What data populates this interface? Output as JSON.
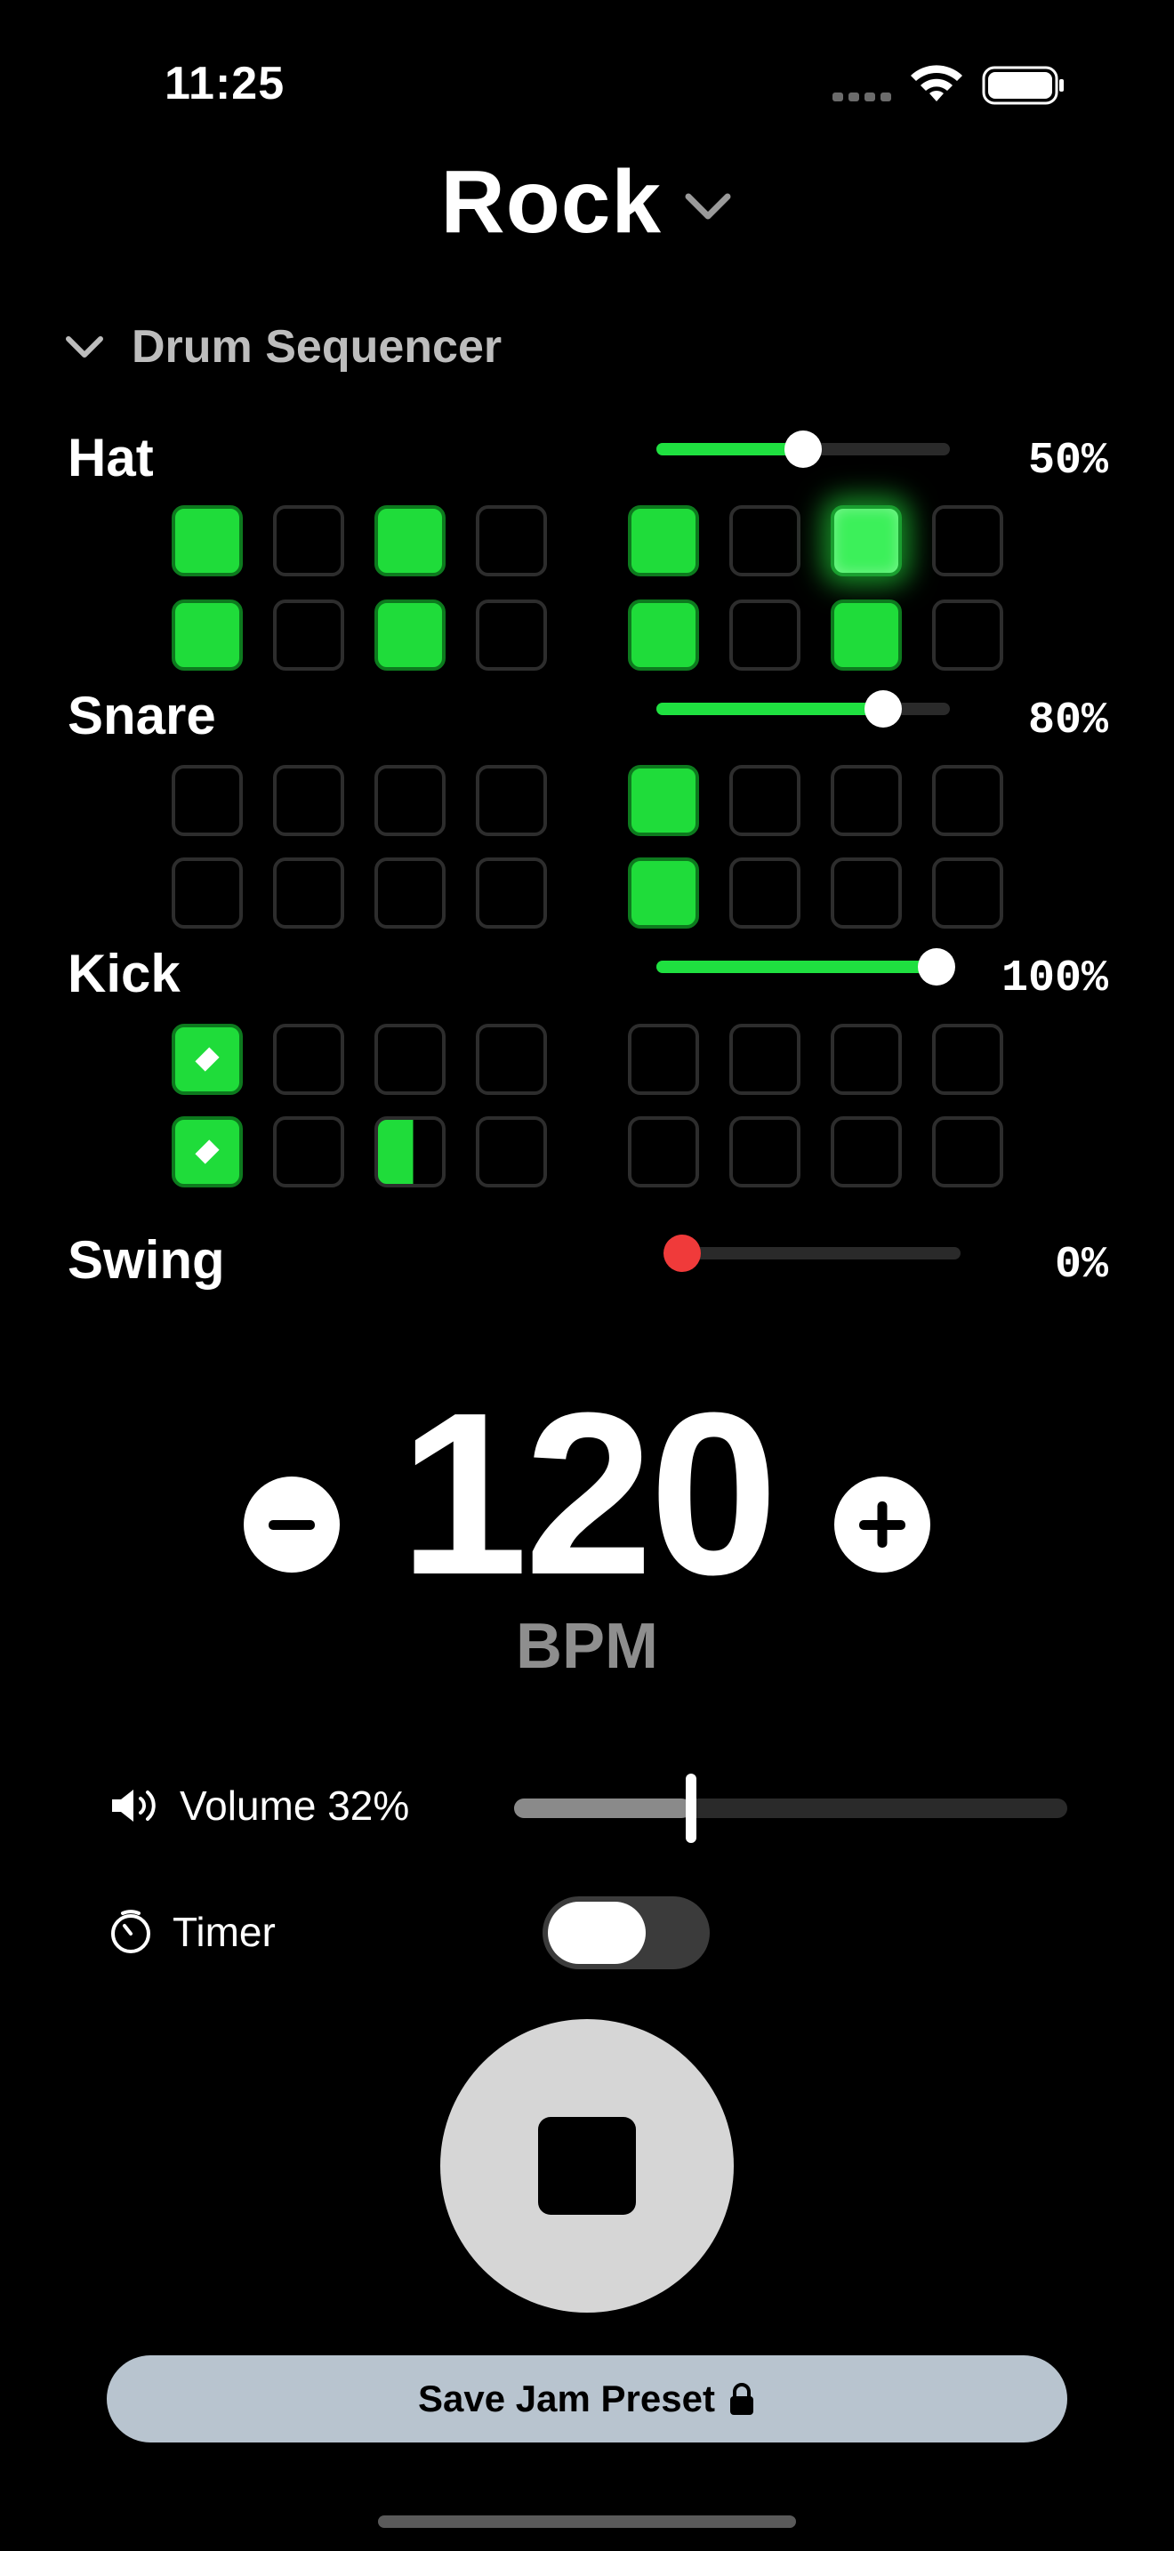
{
  "status_bar": {
    "time": "11:25"
  },
  "header": {
    "title": "Rock"
  },
  "section": {
    "label": "Drum Sequencer"
  },
  "tracks": [
    {
      "name": "Hat",
      "level_text": "50%",
      "level": 0.5
    },
    {
      "name": "Snare",
      "level_text": "80%",
      "level": 0.8
    },
    {
      "name": "Kick",
      "level_text": "100%",
      "level": 1.0
    },
    {
      "name": "Swing",
      "level_text": "0%",
      "level": 0.0
    }
  ],
  "pads": {
    "hat_row1": [
      "on",
      "off",
      "on",
      "off",
      "on",
      "off",
      "glow",
      "off"
    ],
    "hat_row2": [
      "on",
      "off",
      "on",
      "off",
      "on",
      "off",
      "on",
      "off"
    ],
    "snare_row1": [
      "off",
      "off",
      "off",
      "off",
      "on",
      "off",
      "off",
      "off"
    ],
    "snare_row2": [
      "off",
      "off",
      "off",
      "off",
      "on",
      "off",
      "off",
      "off"
    ],
    "kick_row1": [
      "accent",
      "off",
      "off",
      "off",
      "off",
      "off",
      "off",
      "off"
    ],
    "kick_row2": [
      "accent",
      "off",
      "half",
      "off",
      "off",
      "off",
      "off",
      "off"
    ]
  },
  "tempo": {
    "bpm": "120",
    "unit": "BPM"
  },
  "volume": {
    "label": "Volume 32%",
    "level": 0.32
  },
  "timer": {
    "label": "Timer",
    "enabled": false
  },
  "save": {
    "label": "Save Jam Preset"
  },
  "colors": {
    "accent": "#1fdc3a",
    "swing_knob": "#f03a3a",
    "save_bg": "#b8c4cf"
  }
}
